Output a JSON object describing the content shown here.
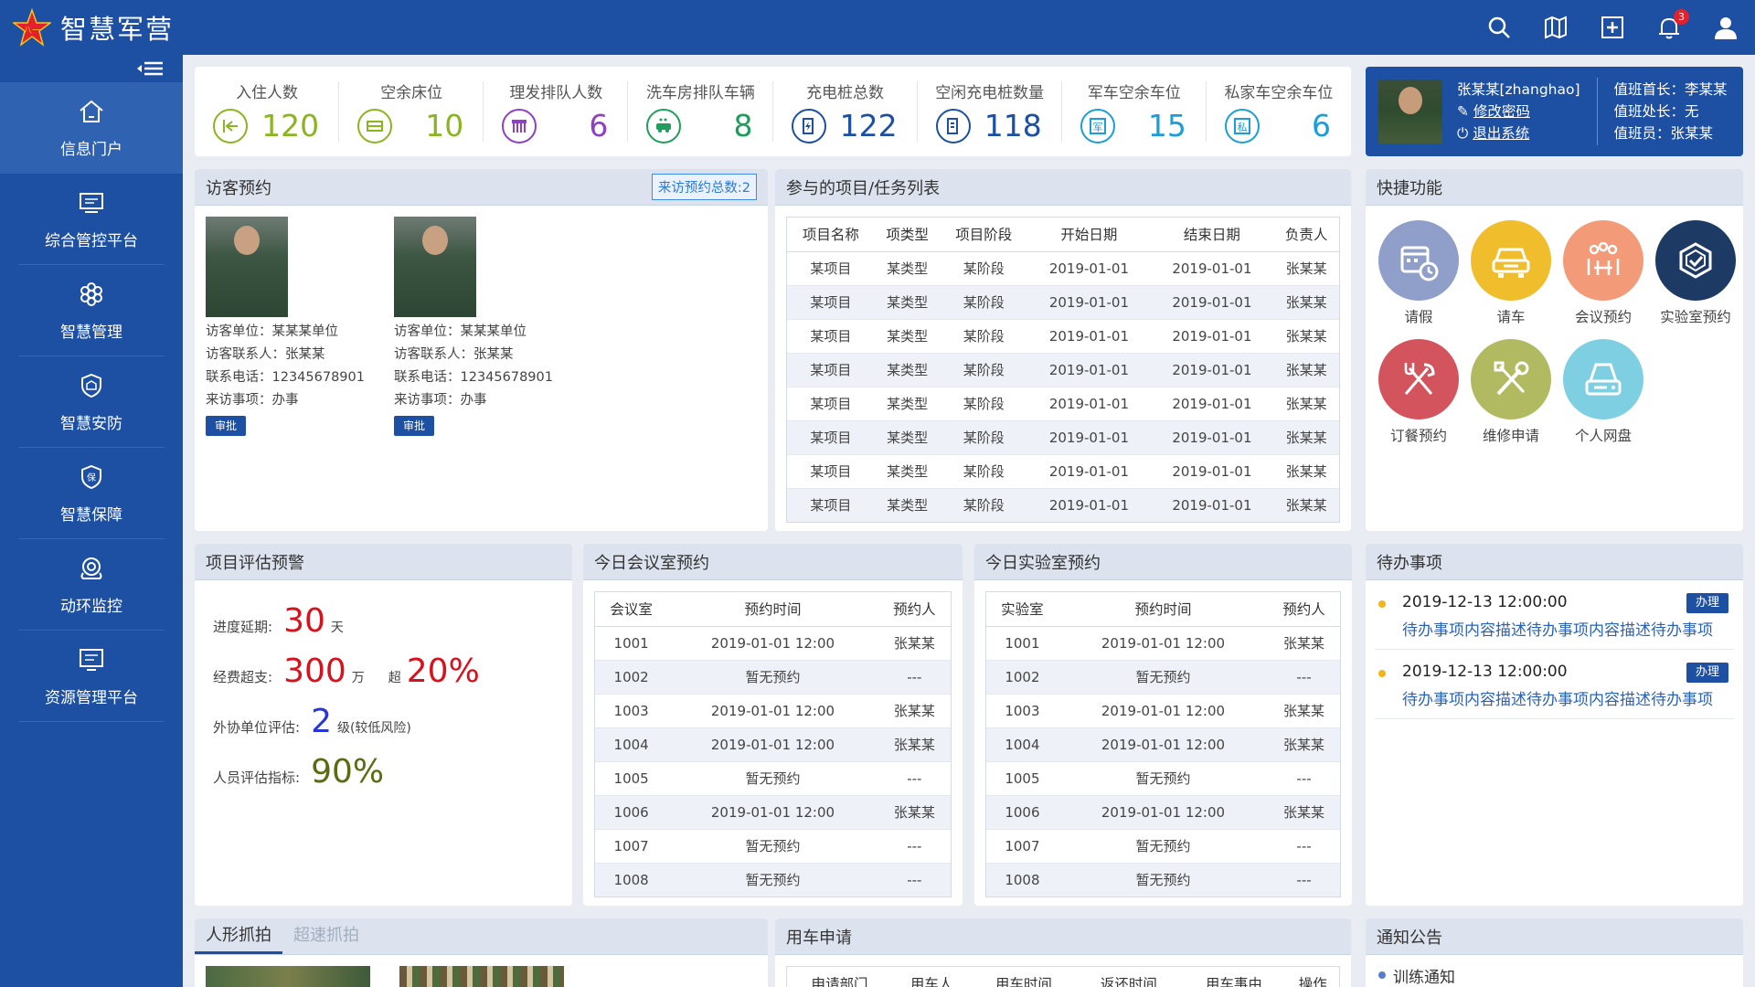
{
  "app": {
    "title": "智慧军营"
  },
  "topbar": {
    "notification_count": "3"
  },
  "sidebar": {
    "items": [
      {
        "label": "信息门户",
        "icon": "home-icon"
      },
      {
        "label": "综合管控平台",
        "icon": "monitor-icon"
      },
      {
        "label": "智慧管理",
        "icon": "flower-icon"
      },
      {
        "label": "智慧安防",
        "icon": "shield-icon"
      },
      {
        "label": "智慧保障",
        "icon": "guarantee-icon"
      },
      {
        "label": "动环监控",
        "icon": "camera-icon"
      },
      {
        "label": "资源管理平台",
        "icon": "screen-icon"
      }
    ]
  },
  "stats": [
    {
      "label": "入住人数",
      "value": "120",
      "color": "#8ab51e",
      "icon": "checkin-icon"
    },
    {
      "label": "空余床位",
      "value": "10",
      "color": "#8ab51e",
      "icon": "bed-icon"
    },
    {
      "label": "理发排队人数",
      "value": "6",
      "color": "#8e3fc4",
      "icon": "comb-icon"
    },
    {
      "label": "洗车房排队车辆",
      "value": "8",
      "color": "#1f9e5b",
      "icon": "carwash-icon"
    },
    {
      "label": "充电桩总数",
      "value": "122",
      "color": "#1d4fa3",
      "icon": "charger-icon"
    },
    {
      "label": "空闲充电桩数量",
      "value": "118",
      "color": "#1d4fa3",
      "icon": "charger-idle-icon"
    },
    {
      "label": "军车空余车位",
      "value": "15",
      "color": "#1b9ed8",
      "icon": "military-parking-icon"
    },
    {
      "label": "私家车空余车位",
      "value": "6",
      "color": "#1b9ed8",
      "icon": "private-parking-icon"
    }
  ],
  "user": {
    "name": "张某某[zhanghao]",
    "change_password": "修改密码",
    "logout": "退出系统",
    "duty_chief": "值班首长：李某某",
    "duty_officer": "值班处长：无",
    "duty_member": "值班员：张某某"
  },
  "visitor": {
    "title": "访客预约",
    "count_label": "来访预约总数:2",
    "items": [
      {
        "unit": "访客单位：某某某单位",
        "contact": "访客联系人：张某某",
        "phone": "联系电话：12345678901",
        "matter": "来访事项：办事",
        "approve": "审批"
      },
      {
        "unit": "访客单位：某某某单位",
        "contact": "访客联系人：张某某",
        "phone": "联系电话：12345678901",
        "matter": "来访事项：办事",
        "approve": "审批"
      }
    ]
  },
  "projects": {
    "title": "参与的项目/任务列表",
    "columns": [
      "项目名称",
      "项类型",
      "项目阶段",
      "开始日期",
      "结束日期",
      "负责人"
    ],
    "rows": [
      [
        "某项目",
        "某类型",
        "某阶段",
        "2019-01-01",
        "2019-01-01",
        "张某某"
      ],
      [
        "某项目",
        "某类型",
        "某阶段",
        "2019-01-01",
        "2019-01-01",
        "张某某"
      ],
      [
        "某项目",
        "某类型",
        "某阶段",
        "2019-01-01",
        "2019-01-01",
        "张某某"
      ],
      [
        "某项目",
        "某类型",
        "某阶段",
        "2019-01-01",
        "2019-01-01",
        "张某某"
      ],
      [
        "某项目",
        "某类型",
        "某阶段",
        "2019-01-01",
        "2019-01-01",
        "张某某"
      ],
      [
        "某项目",
        "某类型",
        "某阶段",
        "2019-01-01",
        "2019-01-01",
        "张某某"
      ],
      [
        "某项目",
        "某类型",
        "某阶段",
        "2019-01-01",
        "2019-01-01",
        "张某某"
      ],
      [
        "某项目",
        "某类型",
        "某阶段",
        "2019-01-01",
        "2019-01-01",
        "张某某"
      ]
    ]
  },
  "shortcuts": {
    "title": "快捷功能",
    "items": [
      {
        "label": "请假",
        "color": "#8f9fc9",
        "icon": "calendar-clock-icon"
      },
      {
        "label": "请车",
        "color": "#f0bd2c",
        "icon": "car-icon"
      },
      {
        "label": "会议预约",
        "color": "#f39a78",
        "icon": "meeting-icon"
      },
      {
        "label": "实验室预约",
        "color": "#1c3a63",
        "icon": "lab-icon"
      },
      {
        "label": "订餐预约",
        "color": "#d4545e",
        "icon": "fork-knife-icon"
      },
      {
        "label": "维修申请",
        "color": "#b1ba61",
        "icon": "tools-icon"
      },
      {
        "label": "个人网盘",
        "color": "#7fcfe3",
        "icon": "disk-icon"
      }
    ]
  },
  "eval": {
    "title": "项目评估预警",
    "delay_label": "进度延期:",
    "delay_value": "30",
    "delay_unit": "天",
    "budget_label": "经费超支:",
    "budget_value": "300",
    "budget_unit": "万",
    "budget_over_label": "超",
    "budget_over_value": "20%",
    "partner_label": "外协单位评估:",
    "partner_value": "2",
    "partner_unit": "级(较低风险)",
    "staff_label": "人员评估指标:",
    "staff_value": "90%",
    "colors": {
      "red": "#d7121d",
      "blue": "#2735d9",
      "olive": "#5c6b12"
    }
  },
  "meeting": {
    "title": "今日会议室预约",
    "columns": [
      "会议室",
      "预约时间",
      "预约人"
    ],
    "rows": [
      [
        "1001",
        "2019-01-01 12:00",
        "张某某"
      ],
      [
        "1002",
        "暂无预约",
        "---"
      ],
      [
        "1003",
        "2019-01-01 12:00",
        "张某某"
      ],
      [
        "1004",
        "2019-01-01 12:00",
        "张某某"
      ],
      [
        "1005",
        "暂无预约",
        "---"
      ],
      [
        "1006",
        "2019-01-01 12:00",
        "张某某"
      ],
      [
        "1007",
        "暂无预约",
        "---"
      ],
      [
        "1008",
        "暂无预约",
        "---"
      ]
    ]
  },
  "lab": {
    "title": "今日实验室预约",
    "columns": [
      "实验室",
      "预约时间",
      "预约人"
    ],
    "rows": [
      [
        "1001",
        "2019-01-01 12:00",
        "张某某"
      ],
      [
        "1002",
        "暂无预约",
        "---"
      ],
      [
        "1003",
        "2019-01-01 12:00",
        "张某某"
      ],
      [
        "1004",
        "2019-01-01 12:00",
        "张某某"
      ],
      [
        "1005",
        "暂无预约",
        "---"
      ],
      [
        "1006",
        "2019-01-01 12:00",
        "张某某"
      ],
      [
        "1007",
        "暂无预约",
        "---"
      ],
      [
        "1008",
        "暂无预约",
        "---"
      ]
    ]
  },
  "todo": {
    "title": "待办事项",
    "items": [
      {
        "time": "2019-12-13 12:00:00",
        "desc": "待办事项内容描述待办事项内容描述待办事项",
        "action": "办理"
      },
      {
        "time": "2019-12-13 12:00:00",
        "desc": "待办事项内容描述待办事项内容描述待办事项",
        "action": "办理"
      }
    ]
  },
  "capture": {
    "tabs": [
      "人形抓拍",
      "超速抓拍"
    ]
  },
  "vehicle": {
    "title": "用车申请",
    "columns": [
      "申请部门",
      "用车人",
      "用车时间",
      "返还时间",
      "用车事由",
      "操作"
    ]
  },
  "notice": {
    "title": "通知公告",
    "items": [
      "训练通知"
    ]
  }
}
